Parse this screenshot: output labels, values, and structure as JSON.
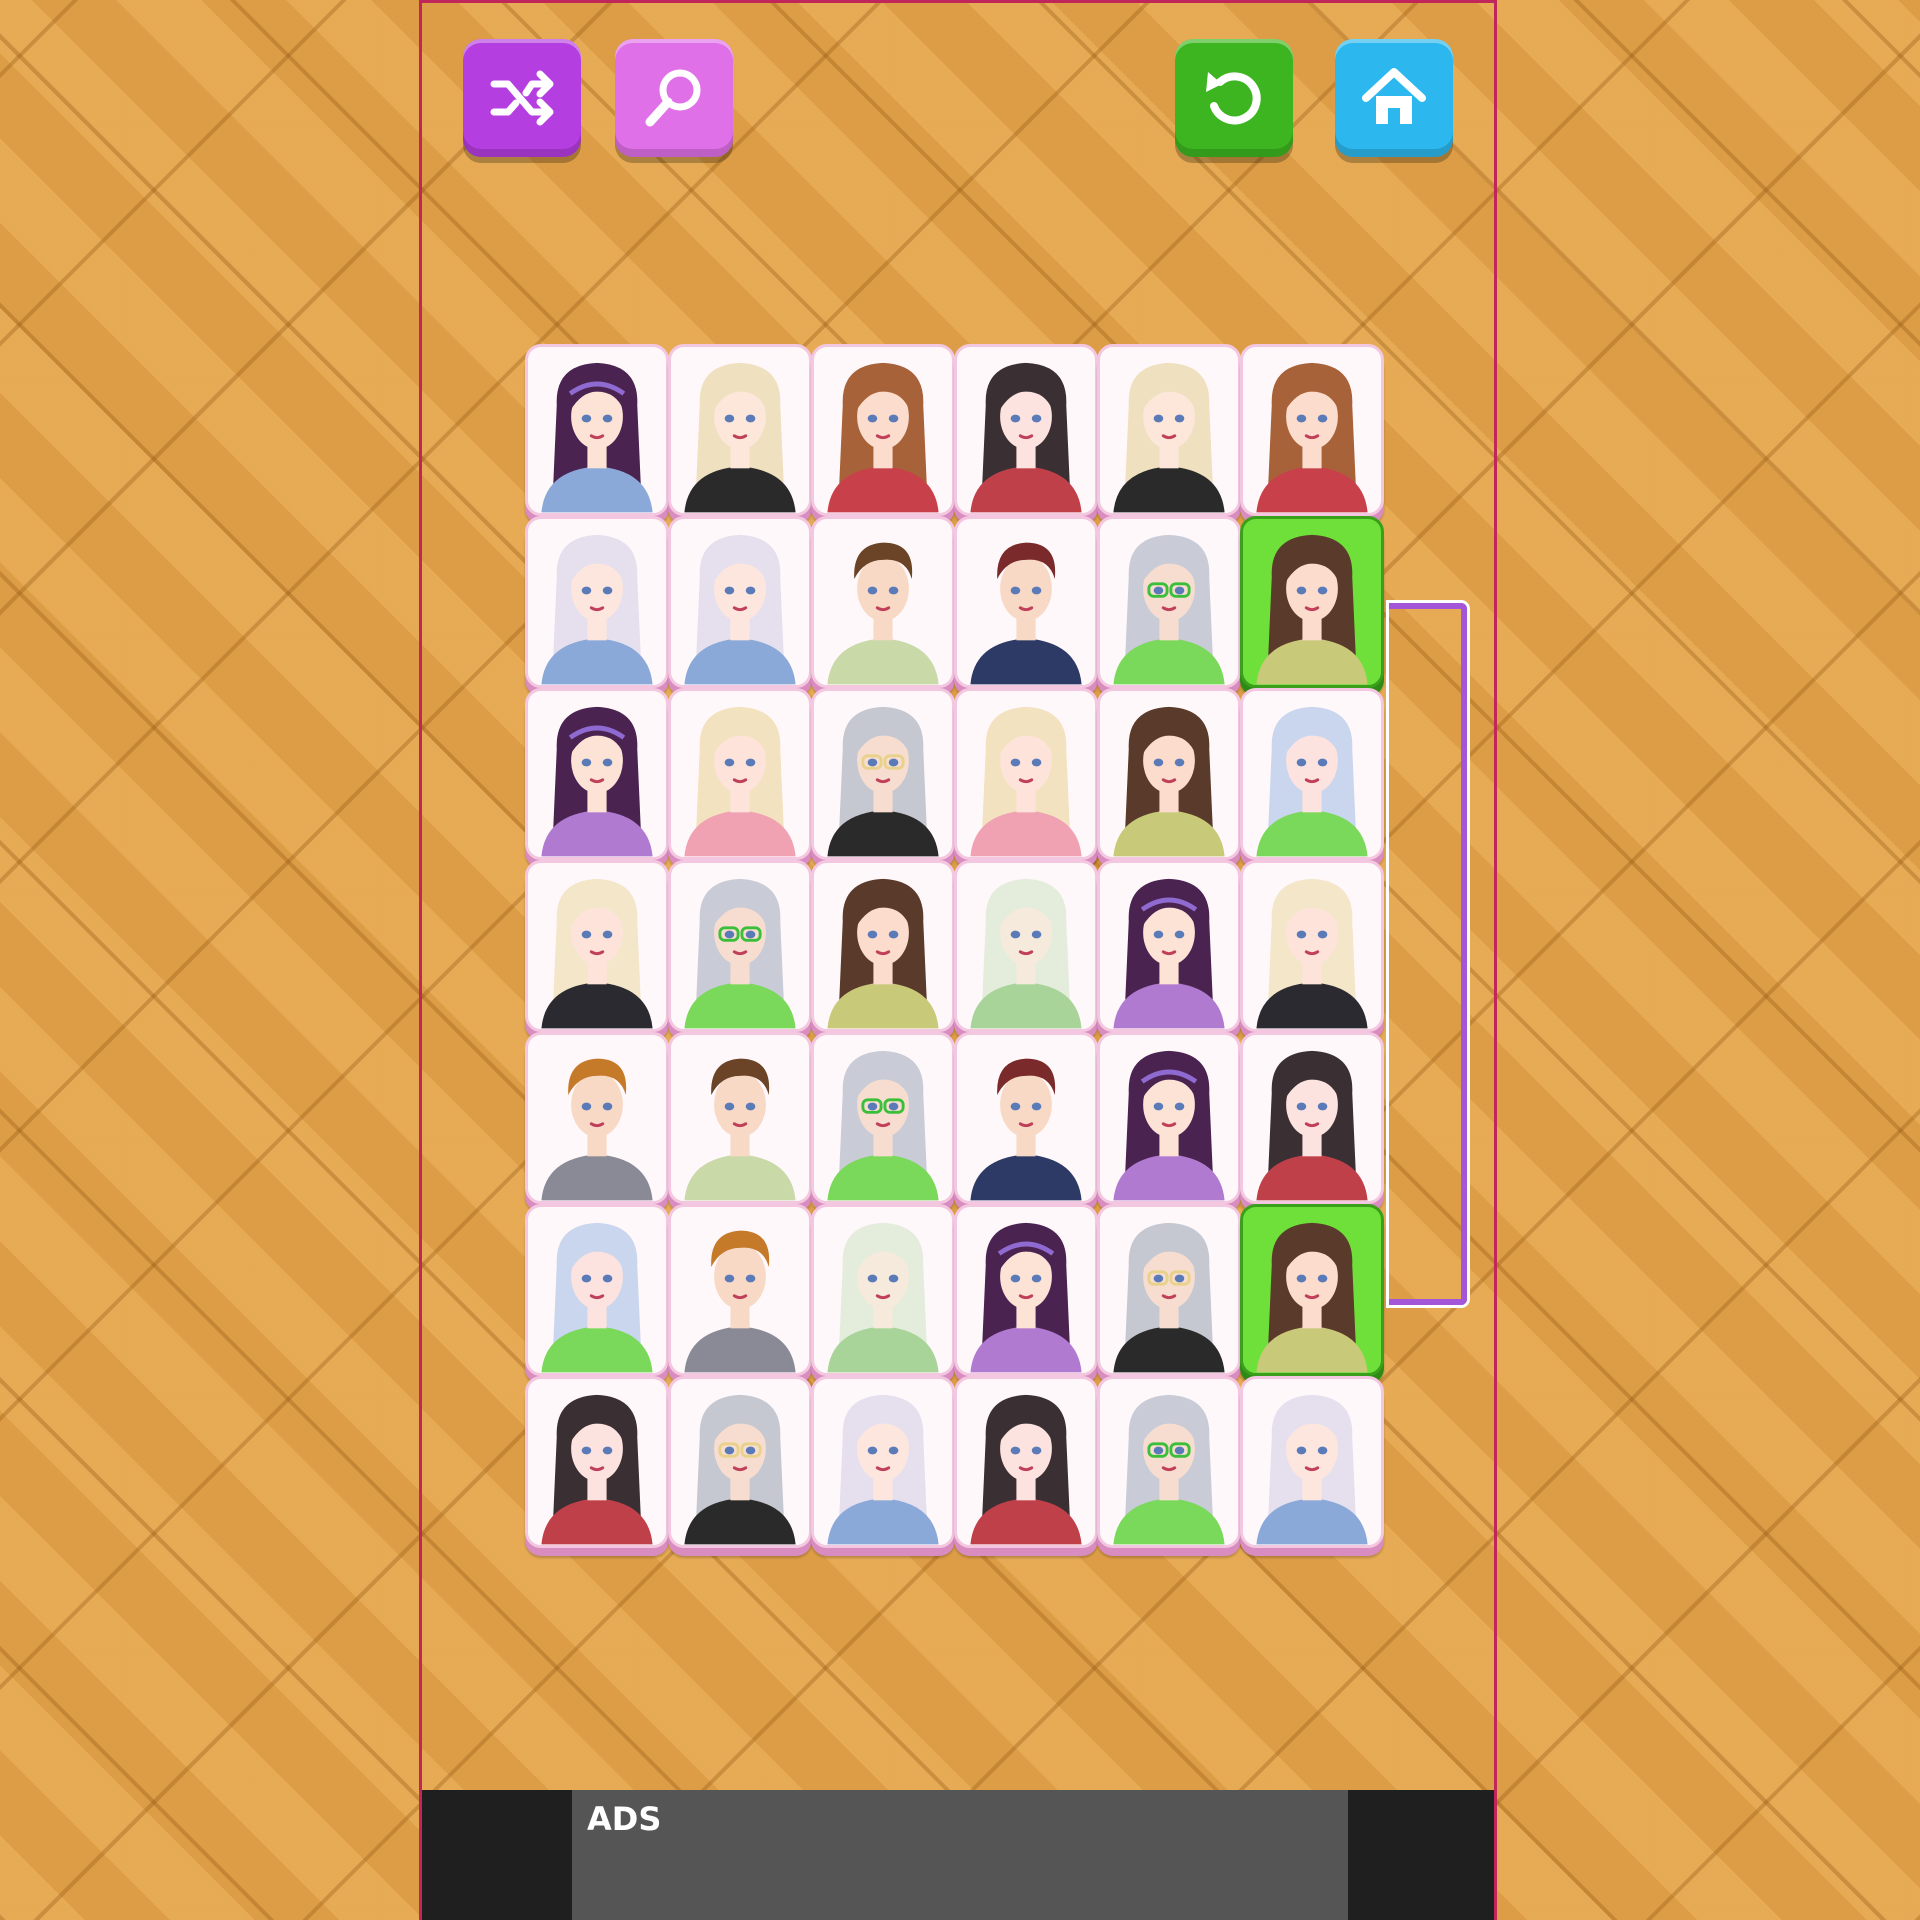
{
  "toolbar": {
    "buttons": [
      {
        "name": "shuffle",
        "icon": "shuffle-icon",
        "color": "#b53ee0"
      },
      {
        "name": "hint",
        "icon": "magnifier-icon",
        "color": "#e070e8"
      },
      {
        "name": "undo",
        "icon": "undo-icon",
        "color": "#3cb520"
      },
      {
        "name": "home",
        "icon": "home-icon",
        "color": "#2cb8ee"
      }
    ]
  },
  "board": {
    "rows": 7,
    "cols": 6,
    "tiles": [
      [
        "girl-purple-headband-blue",
        "girl-blonde-bun-black",
        "girl-auburn-ponytail-rose",
        "girl-dark-wavy-rose",
        "girl-blonde-bun-black",
        "girl-auburn-ponytail-rose"
      ],
      [
        "girl-silver-wavy-blue",
        "girl-silver-wavy-blue",
        "boy-brown-floral",
        "boy-red-hair-navy",
        "girl-silver-green-glasses",
        "girl-brunette-bun-floral"
      ],
      [
        "girl-purple-headband-lilac",
        "girl-blonde-curls-pink",
        "girl-silver-glasses-black",
        "girl-blonde-curls-pink",
        "girl-brunette-bun-floral",
        "girl-blue-curls-green"
      ],
      [
        "girl-blonde-sequin",
        "girl-silver-green-glasses",
        "girl-brunette-bun-floral",
        "girl-elf-green",
        "girl-purple-headband-lilac",
        "girl-blonde-sequin"
      ],
      [
        "boy-ginger-argyle",
        "boy-brown-floral",
        "girl-silver-green-glasses",
        "boy-red-hair-navy",
        "girl-purple-headband-lilac",
        "girl-dark-wavy-rose"
      ],
      [
        "girl-blue-curls-green",
        "boy-ginger-argyle",
        "girl-elf-green",
        "girl-purple-headband-lilac",
        "girl-silver-glasses-black",
        "girl-brunette-bun-floral"
      ],
      [
        "girl-dark-wavy-rose",
        "girl-silver-glasses-black",
        "girl-silver-wavy-blue",
        "girl-dark-wavy-rose",
        "girl-silver-green-glasses",
        "girl-silver-wavy-blue"
      ]
    ],
    "selected": [
      [
        1,
        5
      ],
      [
        5,
        5
      ]
    ],
    "connector_color": "#a356d8"
  },
  "ad": {
    "label": "ADS"
  }
}
